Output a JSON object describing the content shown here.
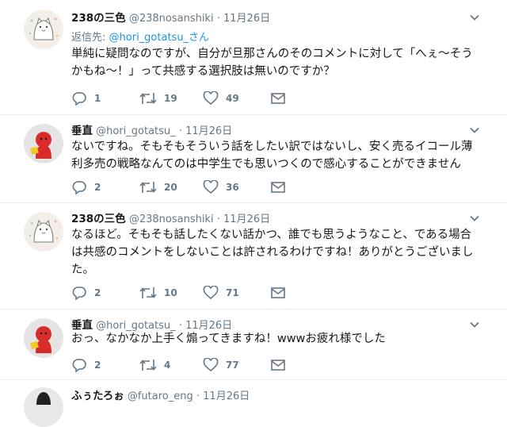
{
  "tweets": [
    {
      "name": "238の三色",
      "handle": "@238nosanshiki",
      "dot": "·",
      "date": "11月26日",
      "reply_prefix": "返信先:",
      "reply_to": "@hori_gotatsu_さん",
      "lines": [
        "単純に疑問なのですが、自分が旦那さんのそのコメントに対して「へぇ～そう",
        "かもね～！」って共感する選択肢は無いのですか？"
      ],
      "replies": "1",
      "retweets": "19",
      "likes": "49",
      "avatar": "cat-avatar"
    },
    {
      "name": "垂直",
      "handle": "@hori_gotatsu_",
      "dot": "·",
      "date": "11月26日",
      "lines": [
        "ないですね。そもそもそういう話をしたい訳ではないし、安く売るイコール薄",
        "利多売の戦略なんてのは中学生でも思いつくので感心することができません"
      ],
      "replies": "2",
      "retweets": "20",
      "likes": "36",
      "avatar": "red-character-avatar"
    },
    {
      "name": "238の三色",
      "handle": "@238nosanshiki",
      "dot": "·",
      "date": "11月26日",
      "lines": [
        "なるほど。そもそも話したくない話かつ、誰でも思うようなこと、である場合",
        "は共感のコメントをしないことは許されるわけですね！ありがとうございまし",
        "た。"
      ],
      "replies": "2",
      "retweets": "10",
      "likes": "71",
      "avatar": "cat-avatar"
    },
    {
      "name": "垂直",
      "handle": "@hori_gotatsu_",
      "dot": "·",
      "date": "11月26日",
      "lines": [
        "おっ、なかなか上手く煽ってきますね！wwwお疲れ様でした"
      ],
      "replies": "2",
      "retweets": "4",
      "likes": "77",
      "avatar": "red-character-avatar"
    },
    {
      "name": "ふぅたろぉ",
      "handle": "@futaro_eng",
      "dot": "·",
      "date": "11月26日",
      "avatar": "dark-avatar"
    }
  ]
}
